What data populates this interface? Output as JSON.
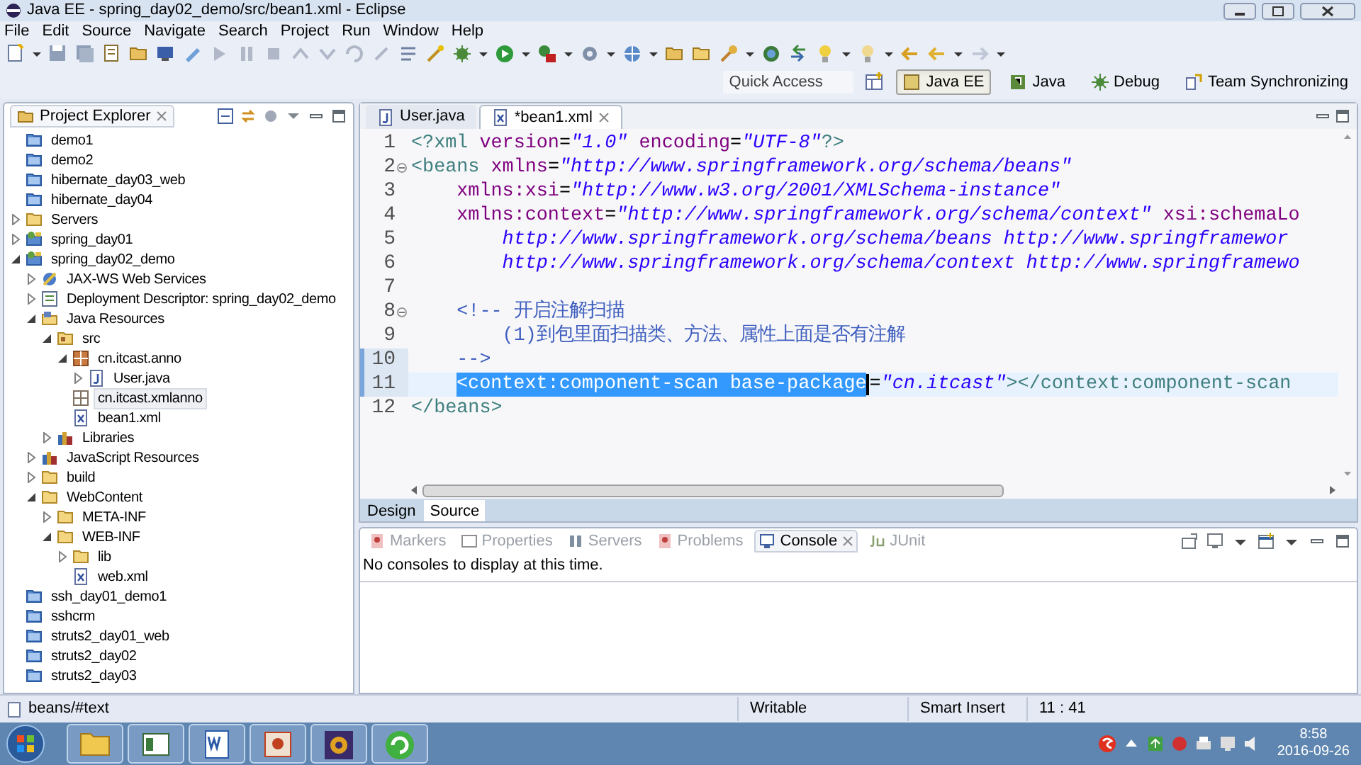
{
  "window": {
    "title": "Java EE - spring_day02_demo/src/bean1.xml - Eclipse"
  },
  "menu": [
    "File",
    "Edit",
    "Source",
    "Navigate",
    "Search",
    "Project",
    "Run",
    "Window",
    "Help"
  ],
  "quick_access": {
    "placeholder": "Quick Access"
  },
  "perspectives": [
    {
      "label": "Java EE",
      "selected": true
    },
    {
      "label": "Java",
      "selected": false
    },
    {
      "label": "Debug",
      "selected": false
    },
    {
      "label": "Team Synchronizing",
      "selected": false
    }
  ],
  "project_explorer": {
    "title": "Project Explorer",
    "tree": [
      {
        "label": "demo1",
        "kind": "project",
        "selected": false
      },
      {
        "label": "demo2",
        "kind": "project",
        "selected": false
      },
      {
        "label": "hibernate_day03_web",
        "kind": "project",
        "selected": false
      },
      {
        "label": "hibernate_day04",
        "kind": "project",
        "selected": false
      },
      {
        "label": "Servers",
        "kind": "folder",
        "expanded": false,
        "selected": false
      },
      {
        "label": "spring_day01",
        "kind": "webproject",
        "expanded": false,
        "selected": false
      },
      {
        "label": "spring_day02_demo",
        "kind": "webproject",
        "expanded": true,
        "selected": false,
        "children": [
          {
            "label": "JAX-WS Web Services",
            "kind": "services",
            "expanded": false,
            "selected": false
          },
          {
            "label": "Deployment Descriptor: spring_day02_demo",
            "kind": "descriptor",
            "expanded": false,
            "selected": false
          },
          {
            "label": "Java Resources",
            "kind": "resources",
            "expanded": true,
            "selected": false,
            "children": [
              {
                "label": "src",
                "kind": "srcfolder",
                "expanded": true,
                "selected": false,
                "children": [
                  {
                    "label": "cn.itcast.anno",
                    "kind": "package",
                    "expanded": true,
                    "selected": false,
                    "children": [
                      {
                        "label": "User.java",
                        "kind": "java",
                        "expanded": false,
                        "selected": false
                      }
                    ]
                  },
                  {
                    "label": "cn.itcast.xmlanno",
                    "kind": "emptypackage",
                    "selected": true
                  },
                  {
                    "label": "bean1.xml",
                    "kind": "xml",
                    "selected": false
                  }
                ]
              },
              {
                "label": "Libraries",
                "kind": "library",
                "expanded": false,
                "selected": false
              }
            ]
          },
          {
            "label": "JavaScript Resources",
            "kind": "library",
            "expanded": false,
            "selected": false
          },
          {
            "label": "build",
            "kind": "folder",
            "expanded": false,
            "selected": false
          },
          {
            "label": "WebContent",
            "kind": "folder",
            "expanded": true,
            "selected": false,
            "children": [
              {
                "label": "META-INF",
                "kind": "folder",
                "expanded": false,
                "selected": false
              },
              {
                "label": "WEB-INF",
                "kind": "folder",
                "expanded": true,
                "selected": false,
                "children": [
                  {
                    "label": "lib",
                    "kind": "folder",
                    "expanded": false,
                    "selected": false
                  },
                  {
                    "label": "web.xml",
                    "kind": "xml",
                    "selected": false
                  }
                ]
              }
            ]
          }
        ]
      },
      {
        "label": "ssh_day01_demo1",
        "kind": "project",
        "selected": false
      },
      {
        "label": "sshcrm",
        "kind": "project",
        "selected": false
      },
      {
        "label": "struts2_day01_web",
        "kind": "project",
        "selected": false
      },
      {
        "label": "struts2_day02",
        "kind": "project",
        "selected": false
      },
      {
        "label": "struts2_day03",
        "kind": "project",
        "selected": false
      }
    ]
  },
  "editor": {
    "tabs": [
      {
        "label": "User.java",
        "kind": "java",
        "selected": false
      },
      {
        "label": "*bean1.xml",
        "kind": "xml",
        "selected": true
      }
    ],
    "lines": [
      {
        "number": "1",
        "changed": false,
        "foldable": false,
        "current": false,
        "indented": false,
        "segments": [
          {
            "kind": "tag",
            "text": "<?xml"
          },
          {
            "kind": "attr",
            "text": " version"
          },
          {
            "kind": "plain",
            "text": "="
          },
          {
            "kind": "value",
            "text": "\"1.0\""
          },
          {
            "kind": "attr",
            "text": " encoding"
          },
          {
            "kind": "plain",
            "text": "="
          },
          {
            "kind": "value",
            "text": "\"UTF-8\""
          },
          {
            "kind": "tag",
            "text": "?>"
          }
        ]
      },
      {
        "number": "2",
        "changed": false,
        "foldable": true,
        "current": false,
        "indented": false,
        "segments": [
          {
            "kind": "tag",
            "text": "<beans"
          },
          {
            "kind": "attr",
            "text": " xmlns"
          },
          {
            "kind": "plain",
            "text": "="
          },
          {
            "kind": "value",
            "text": "\"http://www.springframework.org/schema/beans\""
          }
        ]
      },
      {
        "number": "3",
        "changed": false,
        "foldable": false,
        "current": false,
        "indented": false,
        "segments": [
          {
            "kind": "attr",
            "text": "    xmlns:xsi"
          },
          {
            "kind": "plain",
            "text": "="
          },
          {
            "kind": "value",
            "text": "\"http://www.w3.org/2001/XMLSchema-instance\""
          }
        ]
      },
      {
        "number": "4",
        "changed": false,
        "foldable": false,
        "current": false,
        "indented": false,
        "segments": [
          {
            "kind": "attr",
            "text": "    xmlns:context"
          },
          {
            "kind": "plain",
            "text": "="
          },
          {
            "kind": "value",
            "text": "\"http://www.springframework.org/schema/context\""
          },
          {
            "kind": "attr",
            "text": " xsi:schemaLo"
          }
        ]
      },
      {
        "number": "5",
        "changed": false,
        "foldable": false,
        "current": false,
        "indented": false,
        "segments": [
          {
            "kind": "value",
            "text": "        http://www.springframework.org/schema/beans http://www.springframewor"
          }
        ]
      },
      {
        "number": "6",
        "changed": false,
        "foldable": false,
        "current": false,
        "indented": false,
        "segments": [
          {
            "kind": "value",
            "text": "        http://www.springframework.org/schema/context http://www.springframewo"
          }
        ]
      },
      {
        "number": "7",
        "changed": false,
        "foldable": false,
        "current": false,
        "indented": false
      },
      {
        "number": "8",
        "changed": false,
        "foldable": true,
        "current": false,
        "indented": false,
        "segments": [
          {
            "kind": "comment",
            "text": "    <!-- 开启注解扫描"
          }
        ]
      },
      {
        "number": "9",
        "changed": false,
        "foldable": false,
        "current": false,
        "indented": false,
        "segments": [
          {
            "kind": "comment",
            "text": "        (1)到包里面扫描类、方法、属性上面是否有注解"
          }
        ]
      },
      {
        "number": "10",
        "changed": true,
        "foldable": false,
        "current": false,
        "indented": false,
        "segments": [
          {
            "kind": "comment",
            "text": "    -->"
          }
        ]
      },
      {
        "number": "11",
        "changed": true,
        "foldable": false,
        "current": true,
        "indented": true,
        "segments": [
          {
            "kind": "selection",
            "text": "<context:component-scan base-package"
          },
          {
            "kind": "plain",
            "text": "="
          },
          {
            "kind": "value",
            "text": "\"cn.itcast\""
          },
          {
            "kind": "tag",
            "text": "></context:component-scan"
          }
        ]
      },
      {
        "number": "12",
        "changed": false,
        "foldable": false,
        "current": false,
        "indented": false,
        "segments": [
          {
            "kind": "tag",
            "text": "</beans>"
          }
        ]
      }
    ],
    "bottom_tabs": [
      {
        "label": "Design",
        "selected": false
      },
      {
        "label": "Source",
        "selected": true
      }
    ]
  },
  "console": {
    "tabs": [
      {
        "label": "Markers",
        "selected": false
      },
      {
        "label": "Properties",
        "selected": false
      },
      {
        "label": "Servers",
        "selected": false
      },
      {
        "label": "Problems",
        "selected": false
      },
      {
        "label": "Console",
        "selected": true
      },
      {
        "label": "JUnit",
        "selected": false
      }
    ],
    "message": "No consoles to display at this time."
  },
  "status_bar": {
    "path": "beans/#text",
    "mode": "Writable",
    "insert": "Smart Insert",
    "position": "11 : 41"
  },
  "taskbar": {
    "time": "8:58",
    "date": "2016-09-26"
  }
}
